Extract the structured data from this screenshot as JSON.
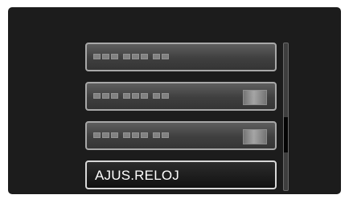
{
  "menu": {
    "items": [
      {
        "label": "",
        "has_value_icon": false
      },
      {
        "label": "",
        "has_value_icon": true
      },
      {
        "label": "",
        "has_value_icon": true
      },
      {
        "label": "AJUS.RELOJ",
        "has_value_icon": false
      }
    ]
  },
  "scroll": {
    "position_fraction": 0.55
  },
  "colors": {
    "screen_background": "#1c1c1c",
    "item_border": "#a8a8a8",
    "item_text": "#ffffff"
  }
}
